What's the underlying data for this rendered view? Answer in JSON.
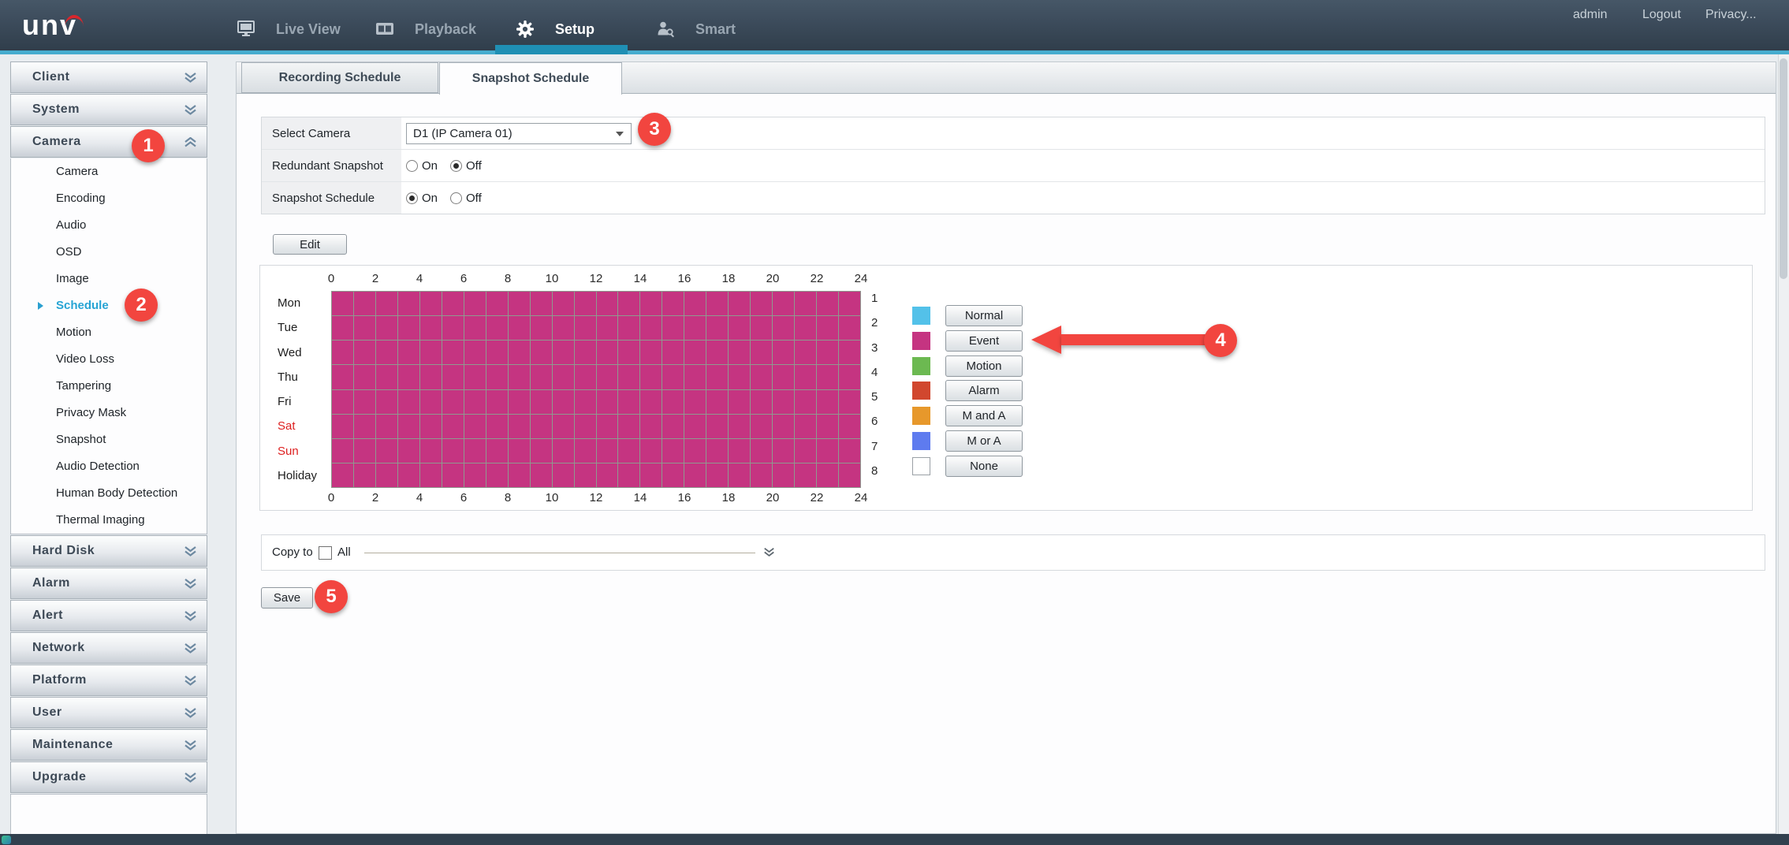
{
  "header": {
    "logo_text": "unv",
    "nav": [
      {
        "label": "Live View",
        "icon": "monitor",
        "active": false
      },
      {
        "label": "Playback",
        "icon": "film",
        "active": false
      },
      {
        "label": "Setup",
        "icon": "gear",
        "active": true
      },
      {
        "label": "Smart",
        "icon": "person-search",
        "active": false
      }
    ],
    "user": "admin",
    "logout_label": "Logout",
    "privacy_label": "Privacy...",
    "accent_color": "#1f8fb4"
  },
  "sidebar": {
    "groups": [
      {
        "label": "Client",
        "expanded": false
      },
      {
        "label": "System",
        "expanded": false
      },
      {
        "label": "Camera",
        "expanded": true,
        "active_item": "Schedule",
        "items": [
          "Camera",
          "Encoding",
          "Audio",
          "OSD",
          "Image",
          "Schedule",
          "Motion",
          "Video Loss",
          "Tampering",
          "Privacy Mask",
          "Snapshot",
          "Audio Detection",
          "Human Body Detection",
          "Thermal Imaging"
        ]
      },
      {
        "label": "Hard Disk",
        "expanded": false
      },
      {
        "label": "Alarm",
        "expanded": false
      },
      {
        "label": "Alert",
        "expanded": false
      },
      {
        "label": "Network",
        "expanded": false
      },
      {
        "label": "Platform",
        "expanded": false
      },
      {
        "label": "User",
        "expanded": false
      },
      {
        "label": "Maintenance",
        "expanded": false
      },
      {
        "label": "Upgrade",
        "expanded": false
      }
    ]
  },
  "tabs": {
    "items": [
      {
        "label": "Recording Schedule",
        "active": false
      },
      {
        "label": "Snapshot Schedule",
        "active": true
      }
    ]
  },
  "form": {
    "select_camera": {
      "label": "Select Camera",
      "value": "D1 (IP Camera 01)"
    },
    "redundant_snapshot": {
      "label": "Redundant Snapshot",
      "value": "Off"
    },
    "snapshot_schedule": {
      "label": "Snapshot Schedule",
      "value": "On"
    },
    "on_label": "On",
    "off_label": "Off"
  },
  "schedule": {
    "edit_label": "Edit",
    "hour_labels": [
      "0",
      "2",
      "4",
      "6",
      "8",
      "10",
      "12",
      "14",
      "16",
      "18",
      "20",
      "22",
      "24"
    ],
    "days": [
      {
        "label": "Mon",
        "red": false
      },
      {
        "label": "Tue",
        "red": false
      },
      {
        "label": "Wed",
        "red": false
      },
      {
        "label": "Thu",
        "red": false
      },
      {
        "label": "Fri",
        "red": false
      },
      {
        "label": "Sat",
        "red": true
      },
      {
        "label": "Sun",
        "red": true
      },
      {
        "label": "Holiday",
        "red": false
      }
    ],
    "row_numbers": [
      "1",
      "2",
      "3",
      "4",
      "5",
      "6",
      "7",
      "8"
    ],
    "grid": {
      "rows": 8,
      "cols": 24,
      "filled_type": "Event",
      "fill_color": "#c53481",
      "line_color": "#8f998f"
    },
    "legend": [
      {
        "label": "Normal",
        "color": "#53c1e9"
      },
      {
        "label": "Event",
        "color": "#c53481"
      },
      {
        "label": "Motion",
        "color": "#6cb951"
      },
      {
        "label": "Alarm",
        "color": "#d1472e"
      },
      {
        "label": "M and A",
        "color": "#e7982b"
      },
      {
        "label": "M or A",
        "color": "#5e7bef"
      },
      {
        "label": "None",
        "color": "#ffffff"
      }
    ]
  },
  "footer": {
    "copy_to_label": "Copy to",
    "all_label": "All",
    "all_checked": false,
    "save_label": "Save"
  },
  "annotations": {
    "callouts": [
      "1",
      "2",
      "3",
      "4",
      "5"
    ],
    "color": "#f2453f"
  }
}
